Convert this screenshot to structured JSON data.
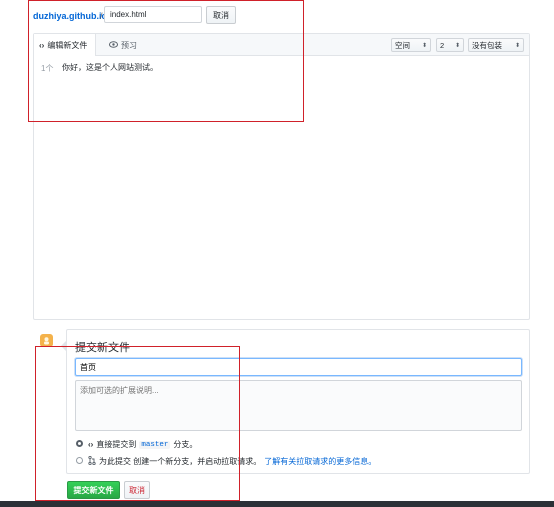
{
  "path_bar": {
    "repo": "duzhiya.github.io",
    "separator": "/",
    "filename": "index.html",
    "cancel_label": "取消"
  },
  "editor": {
    "tab_edit": "编辑新文件",
    "tab_preview": "预习",
    "indent_mode": "空间",
    "indent_size": "2",
    "wrap_mode": "没有包装",
    "lines": [
      {
        "number": "1个",
        "text": "你好，这是个人网站测试。"
      }
    ]
  },
  "commit": {
    "title": "提交新文件",
    "summary_value": "首页",
    "description_placeholder": "添加可选的扩展说明...",
    "option_direct": {
      "prefix": "直接提交到",
      "branch": "master",
      "suffix": "分支。"
    },
    "option_new_branch": {
      "text": "为此提交 创建一个新分支，并启动拉取请求。",
      "link": "了解有关拉取请求的更多信息。"
    },
    "commit_button": "提交新文件",
    "cancel_button": "取消"
  },
  "colors": {
    "link": "#0366d6",
    "commit_button": "#28a745",
    "annotation_red": "#d0212a",
    "cancel_red": "#cb2431"
  }
}
